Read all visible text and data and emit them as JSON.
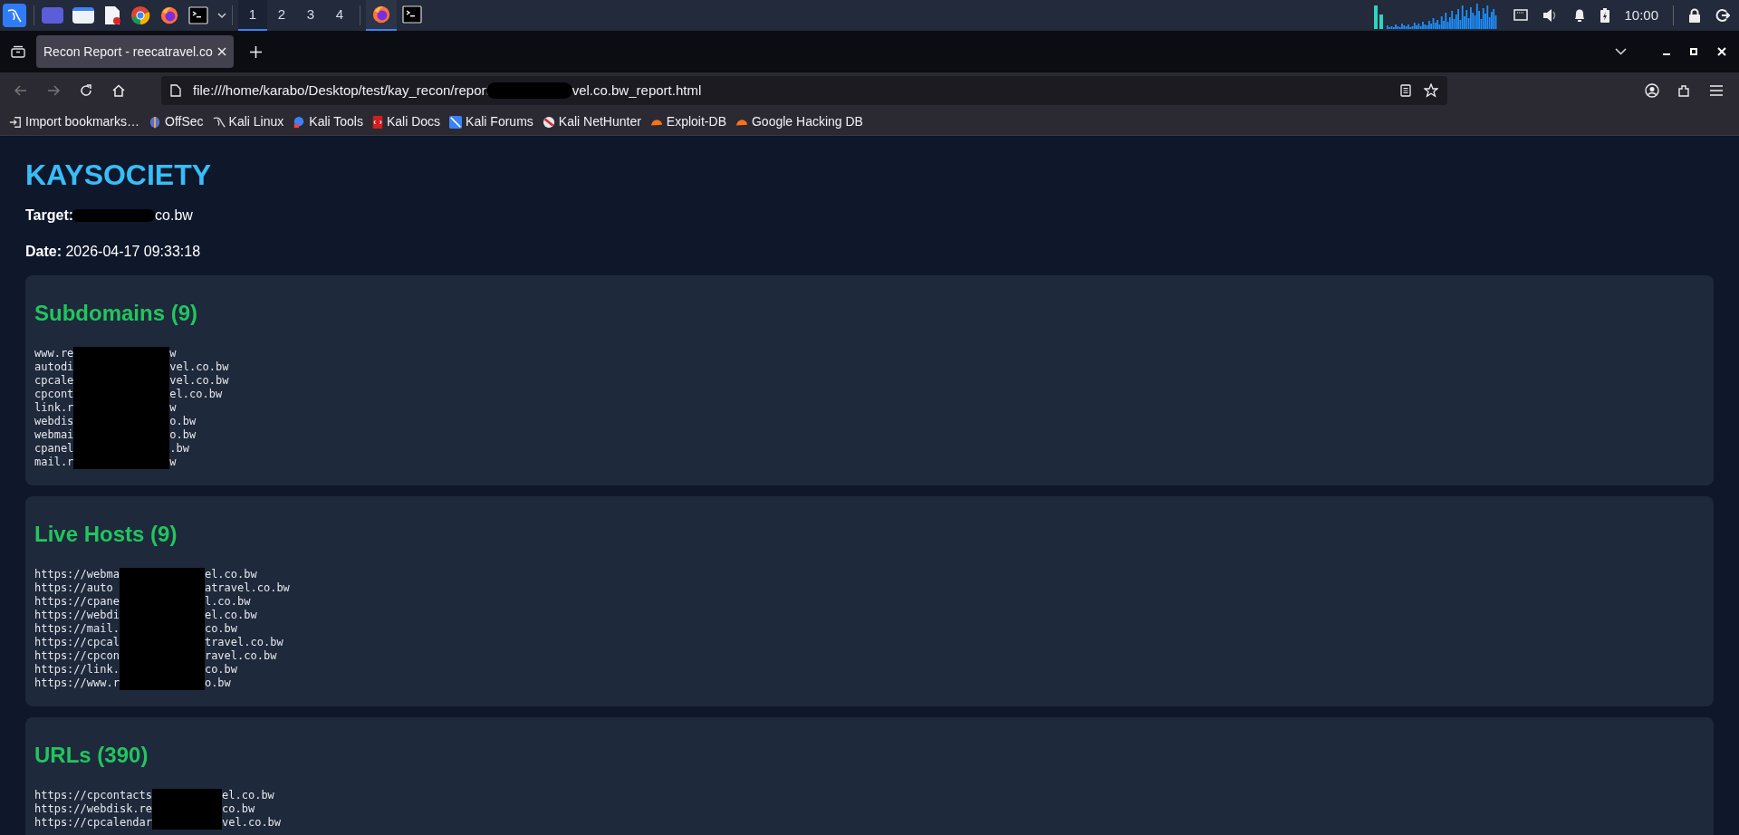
{
  "taskbar": {
    "workspaces": [
      {
        "label": "1",
        "selected": true
      },
      {
        "label": "2",
        "selected": false
      },
      {
        "label": "3",
        "selected": false
      },
      {
        "label": "4",
        "selected": false
      }
    ],
    "tasks": [
      {
        "kind": "firefox",
        "selected": true
      },
      {
        "kind": "terminal",
        "selected": false
      }
    ],
    "clock": "10:00"
  },
  "browser": {
    "tab": {
      "title": "Recon Report - reecatravel.co",
      "selected": true
    },
    "url": {
      "before": "file:///home/karabo/Desktop/test/kay_recon/report",
      "after": "vel.co.bw_report.html"
    },
    "bookmarks": [
      {
        "kind": "import",
        "label": "Import bookmarks…"
      },
      {
        "kind": "offsec",
        "label": "OffSec"
      },
      {
        "kind": "kali",
        "label": "Kali Linux"
      },
      {
        "kind": "tools",
        "label": "Kali Tools"
      },
      {
        "kind": "docs",
        "label": "Kali Docs"
      },
      {
        "kind": "forums",
        "label": "Kali Forums"
      },
      {
        "kind": "nethunter",
        "label": "Kali NetHunter"
      },
      {
        "kind": "exploit",
        "label": "Exploit-DB"
      },
      {
        "kind": "exploit",
        "label": "Google Hacking DB"
      }
    ]
  },
  "report": {
    "title": "KAYSOCIETY",
    "target": {
      "label": "Target:",
      "value": "co.bw"
    },
    "date": {
      "label": "Date:",
      "value": "2026-04-17 09:33:18"
    },
    "sections": [
      {
        "heading": "Subdomains (9)",
        "lines": [
          {
            "left": "www.re",
            "right": "w"
          },
          {
            "left": "autodi",
            "right": "vel.co.bw"
          },
          {
            "left": "cpcale",
            "right": "vel.co.bw"
          },
          {
            "left": "cpcont",
            "right": "el.co.bw"
          },
          {
            "left": "link.r",
            "right": "w"
          },
          {
            "left": "webdis",
            "right": "o.bw"
          },
          {
            "left": "webmai",
            "right": "o.bw"
          },
          {
            "left": "cpanel",
            "right": ".bw"
          },
          {
            "left": "mail.r",
            "right": "w"
          }
        ]
      },
      {
        "heading": "Live Hosts (9)",
        "lines": [
          {
            "left": "https://webma",
            "right": "el.co.bw"
          },
          {
            "left": "https://auto",
            "right": "atravel.co.bw"
          },
          {
            "left": "https://cpane",
            "right": "l.co.bw"
          },
          {
            "left": "https://webdi",
            "right": "el.co.bw"
          },
          {
            "left": "https://mail.",
            "right": "co.bw"
          },
          {
            "left": "https://cpcal",
            "right": "travel.co.bw"
          },
          {
            "left": "https://cpcon",
            "right": "ravel.co.bw"
          },
          {
            "left": "https://link.",
            "right": "co.bw"
          },
          {
            "left": "https://www.r",
            "right": "o.bw"
          }
        ]
      },
      {
        "heading": "URLs (390)",
        "lines": [
          {
            "left": "https://cpcontacts",
            "right": "el.co.bw"
          },
          {
            "left": "https://webdisk.re",
            "right": "co.bw"
          },
          {
            "left": "https://cpcalendar",
            "right": "vel.co.bw"
          }
        ]
      }
    ]
  }
}
